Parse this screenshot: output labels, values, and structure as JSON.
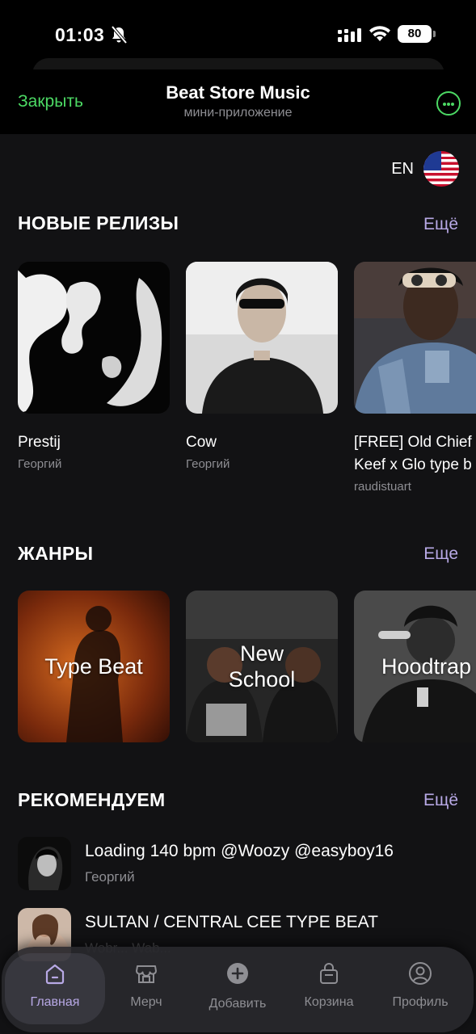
{
  "status_bar": {
    "time": "01:03",
    "battery": "80"
  },
  "app_header": {
    "close_label": "Закрыть",
    "title": "Beat Store Music",
    "subtitle": "мини-приложение"
  },
  "language": {
    "code": "EN"
  },
  "new_releases": {
    "title": "НОВЫЕ РЕЛИЗЫ",
    "more_label": "Ещё",
    "items": [
      {
        "title": "Prestij",
        "author": "Георгий"
      },
      {
        "title": "Cow",
        "author": "Георгий"
      },
      {
        "title_line1": "[FREE] Old Chief",
        "title_line2": "Keef x  Glo type b",
        "author": "raudistuart"
      }
    ]
  },
  "genres": {
    "title": "ЖАНРЫ",
    "more_label": "Еще",
    "items": [
      {
        "label": "Type Beat"
      },
      {
        "label_line1": "New",
        "label_line2": "School"
      },
      {
        "label": "Hoodtrap"
      }
    ]
  },
  "recommended": {
    "title": "РЕКОМЕНДУЕМ",
    "more_label": "Ещё",
    "items": [
      {
        "title": "Loading 140 bpm @Woozy @easyboy16",
        "author": "Георгий"
      },
      {
        "title": "SULTAN / CENTRAL CEE TYPE BEAT",
        "author": "Wobr... Wab..."
      }
    ]
  },
  "bottom_nav": {
    "items": [
      {
        "label": "Главная",
        "icon": "home-icon",
        "active": true
      },
      {
        "label": "Мерч",
        "icon": "shop-icon"
      },
      {
        "label": "Добавить",
        "icon": "add-icon"
      },
      {
        "label": "Корзина",
        "icon": "bag-icon"
      },
      {
        "label": "Профиль",
        "icon": "profile-icon"
      }
    ]
  },
  "colors": {
    "accent_green": "#4cd964",
    "accent_lavender": "#b8a9e6",
    "background": "#121214"
  }
}
